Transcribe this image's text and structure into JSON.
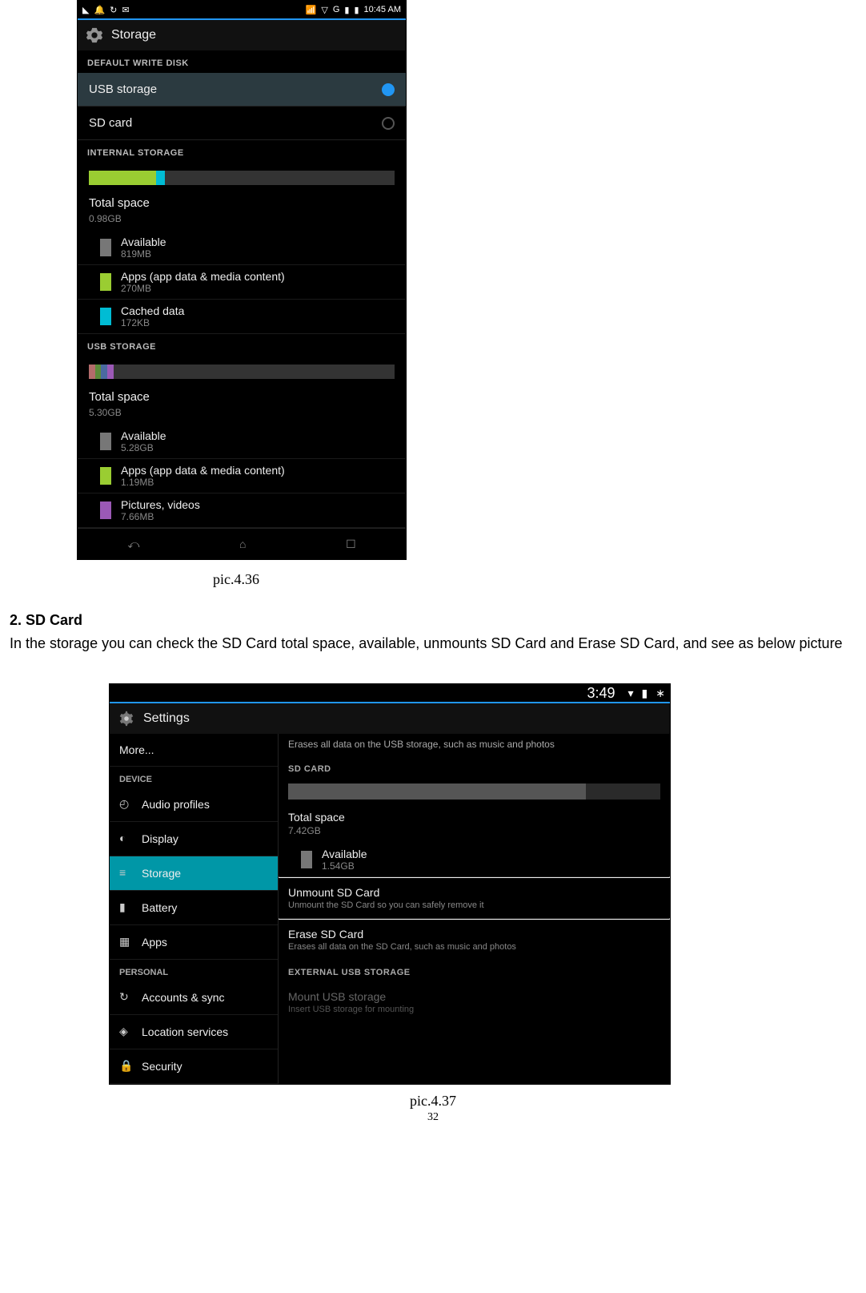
{
  "doc": {
    "caption1": "pic.4.36",
    "section_heading": "2. SD Card",
    "body_paragraph": "In the storage you can check the SD Card total space, available, unmounts SD Card and Erase SD Card, and see as below picture",
    "caption2": "pic.4.37",
    "page_number": "32"
  },
  "phone1": {
    "status": {
      "time": "10:45 AM",
      "net_label": "G",
      "signal_icons": [
        "triangle",
        "wifi",
        "nav",
        "G",
        "sig",
        "batt"
      ]
    },
    "app_title": "Storage",
    "section_default_write": "DEFAULT WRITE DISK",
    "radio_usb": "USB storage",
    "radio_sd": "SD card",
    "section_internal": "INTERNAL STORAGE",
    "internal": {
      "bar_segments": [
        {
          "color": "#9acd32",
          "pct": 22
        },
        {
          "color": "#00bcd4",
          "pct": 3
        },
        {
          "color": "#333",
          "pct": 75
        }
      ],
      "total_label": "Total space",
      "total_value": "0.98GB",
      "items": [
        {
          "swatch": "#777",
          "label": "Available",
          "value": "819MB"
        },
        {
          "swatch": "#9acd32",
          "label": "Apps (app data & media content)",
          "value": "270MB"
        },
        {
          "swatch": "#00bcd4",
          "label": "Cached data",
          "value": "172KB"
        }
      ]
    },
    "section_usb": "USB STORAGE",
    "usb": {
      "bar_segments": [
        {
          "color": "#b36b6b",
          "pct": 2
        },
        {
          "color": "#5b8a3a",
          "pct": 2
        },
        {
          "color": "#4a6aa0",
          "pct": 2
        },
        {
          "color": "#9b59b6",
          "pct": 2
        },
        {
          "color": "#333",
          "pct": 92
        }
      ],
      "total_label": "Total space",
      "total_value": "5.30GB",
      "items": [
        {
          "swatch": "#777",
          "label": "Available",
          "value": "5.28GB"
        },
        {
          "swatch": "#9acd32",
          "label": "Apps (app data & media content)",
          "value": "1.19MB"
        },
        {
          "swatch": "#9b59b6",
          "label": "Pictures, videos",
          "value": "7.66MB"
        }
      ]
    }
  },
  "tablet": {
    "status": {
      "time": "3:49"
    },
    "app_title": "Settings",
    "left_nav": {
      "more": "More...",
      "device_header": "DEVICE",
      "items": [
        {
          "icon": "audio",
          "label": "Audio profiles"
        },
        {
          "icon": "display",
          "label": "Display"
        },
        {
          "icon": "storage",
          "label": "Storage",
          "active": true
        },
        {
          "icon": "battery",
          "label": "Battery"
        },
        {
          "icon": "apps",
          "label": "Apps"
        }
      ],
      "personal_header": "PERSONAL",
      "personal_items": [
        {
          "icon": "sync",
          "label": "Accounts & sync"
        },
        {
          "icon": "location",
          "label": "Location services"
        },
        {
          "icon": "lock",
          "label": "Security"
        }
      ]
    },
    "right": {
      "erase_usb_desc": "Erases all data on the USB storage, such as music and photos",
      "sd_header": "SD CARD",
      "bar_segments": [
        {
          "color": "#555",
          "pct": 80
        },
        {
          "color": "#2a2a2a",
          "pct": 20
        }
      ],
      "total_label": "Total space",
      "total_value": "7.42GB",
      "available": {
        "swatch": "#777",
        "label": "Available",
        "value": "1.54GB"
      },
      "unmount_title": "Unmount SD Card",
      "unmount_desc": "Unmount the SD Card so you can safely remove it",
      "erase_title": "Erase SD Card",
      "erase_desc": "Erases all data on the SD Card, such as music and photos",
      "ext_header": "EXTERNAL USB STORAGE",
      "mount_title": "Mount USB storage",
      "mount_desc": "Insert USB storage for mounting"
    }
  }
}
